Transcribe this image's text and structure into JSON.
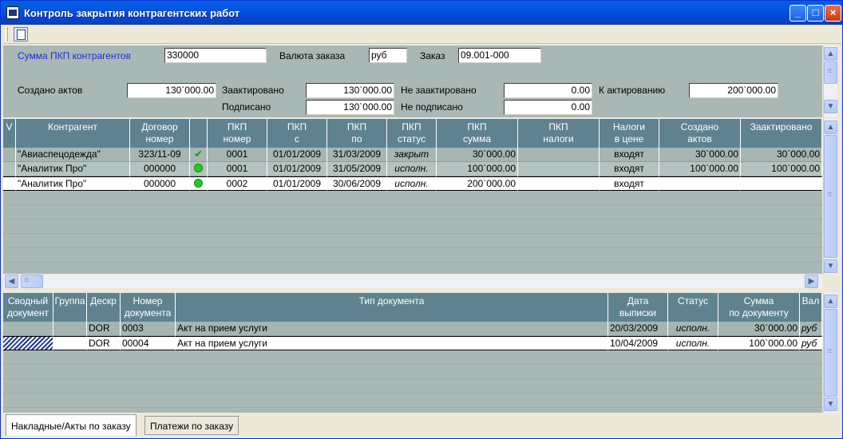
{
  "window": {
    "title": "Контроль закрытия контрагентских работ"
  },
  "top_form": {
    "pkp_sum_label": "Сумма ПКП контрагентов",
    "pkp_sum_value": "330000",
    "currency_label": "Валюта заказа",
    "currency_value": "руб",
    "order_label": "Заказ",
    "order_value": "09.001-000",
    "created_label": "Создано актов",
    "created_value": "130`000.00",
    "actuated_label": "Заактировано",
    "actuated_value": "130`000.00",
    "not_actuated_label": "Не заактировано",
    "not_actuated_value": "0.00",
    "to_actuate_label": "К актированию",
    "to_actuate_value": "200`000.00",
    "signed_label": "Подписано",
    "signed_value": "130`000.00",
    "not_signed_label": "Не подписано",
    "not_signed_value": "0.00"
  },
  "grid1": {
    "headers": [
      "V",
      "Контрагент",
      "Договор\nномер",
      "",
      "ПКП\nномер",
      "ПКП\nс",
      "ПКП\nпо",
      "ПКП\nстатус",
      "ПКП\nсумма",
      "ПКП\nналоги",
      "Налоги\nв цене",
      "Создано\nактов",
      "Заактировано"
    ],
    "rows": [
      {
        "contractor": "\"Авиаспецодежда\"",
        "contract": "323/11-09",
        "status_icon": "checkmark-icon",
        "pkp_no": "0001",
        "from": "01/01/2009",
        "to": "31/03/2009",
        "status": "закрыт",
        "sum": "30`000.00",
        "taxes": "",
        "tax_in_price": "входят",
        "created": "30`000.00",
        "actuated": "30`000.00"
      },
      {
        "contractor": "\"Аналитик Про\"",
        "contract": "000000",
        "status_icon": "green-dot-icon",
        "pkp_no": "0001",
        "from": "01/01/2009",
        "to": "31/05/2009",
        "status": "исполн.",
        "sum": "100`000.00",
        "taxes": "",
        "tax_in_price": "входят",
        "created": "100`000.00",
        "actuated": "100`000.00"
      },
      {
        "contractor": "\"Аналитик Про\"",
        "contract": "000000",
        "status_icon": "green-dot-icon",
        "pkp_no": "0002",
        "from": "01/01/2009",
        "to": "30/06/2009",
        "status": "исполн.",
        "sum": "200`000.00",
        "taxes": "",
        "tax_in_price": "входят",
        "created": "",
        "actuated": ""
      }
    ]
  },
  "grid2": {
    "headers": [
      "Сводный\nдокумент",
      "Группа",
      "Дескр",
      "Номер\nдокумента",
      "Тип документа",
      "Дата\nвыписки",
      "Статус",
      "Сумма\nпо документу",
      "Вал"
    ],
    "rows": [
      {
        "summary": "",
        "group": "",
        "descr": "DOR",
        "number": "0003",
        "type": "Акт на прием услуги",
        "date": "20/03/2009",
        "status": "исполн.",
        "sum": "30`000.00",
        "cur": "руб"
      },
      {
        "summary": "",
        "group": "",
        "descr": "DOR",
        "number": "00004",
        "type": "Акт на прием услуги",
        "date": "10/04/2009",
        "status": "исполн.",
        "sum": "100`000.00",
        "cur": "руб"
      }
    ]
  },
  "tabs": [
    "Накладные/Акты по заказу",
    "Платежи по заказу"
  ],
  "colors": {
    "title_bar": "#0058e6",
    "grid_header": "#5f8290",
    "grid_bg": "#a9b8b5",
    "status_ok": "#22cc22"
  }
}
